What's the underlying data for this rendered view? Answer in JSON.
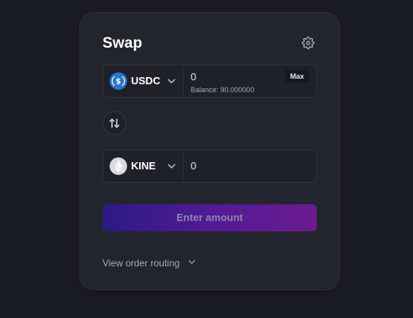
{
  "swap": {
    "title": "Swap",
    "settings_icon": "gear-icon",
    "from": {
      "token": "USDC",
      "token_icon": "usdc-icon",
      "amount": "0",
      "balance": "Balance: 90.000000",
      "max_label": "Max"
    },
    "switch_icon": "swap-arrows-icon",
    "to": {
      "token": "KINE",
      "token_icon": "kine-icon",
      "amount": "0"
    },
    "submit_label": "Enter amount",
    "routing_label": "View order routing"
  },
  "colors": {
    "background": "#1b1d24",
    "card": "#23252e",
    "usdc": "#2775ca",
    "cta_gradient_start": "#2c1a82",
    "cta_gradient_end": "#6b1b8f"
  }
}
